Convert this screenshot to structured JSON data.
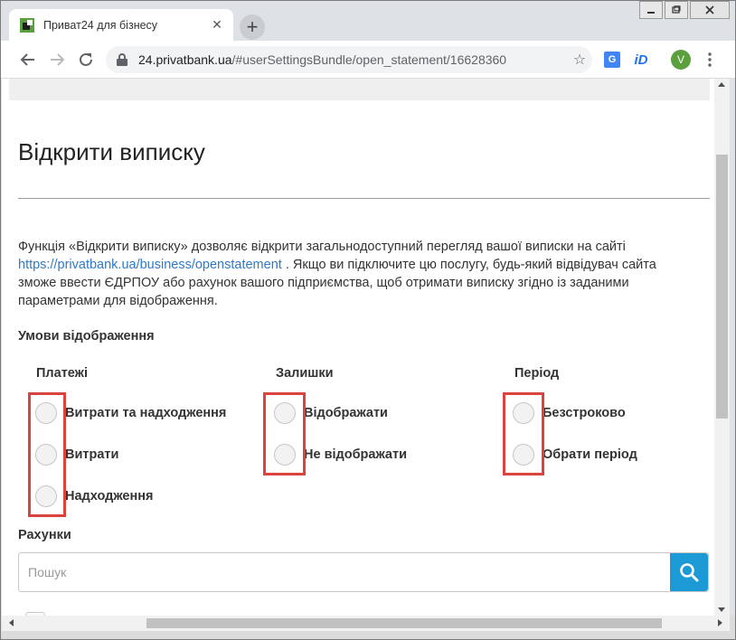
{
  "browser": {
    "tab_title": "Приват24 для бізнесу",
    "tab_close": "✕",
    "new_tab": "+",
    "url_host": "24.privatbank.ua",
    "url_path": "/#userSettingsBundle/open_statement/16628360",
    "profile_initial": "V",
    "id_ext": "iD",
    "translate_ext": "G"
  },
  "page": {
    "title": "Відкрити виписку",
    "description_before_link": "Функція «Відкрити виписку» дозволяє відкрити загальнодоступний перегляд вашої виписки на сайті ",
    "description_link": "https://privatbank.ua/business/openstatement",
    "description_after_link": " . Якщо ви підключите цю послугу, будь-який відвідувач сайта зможе ввести ЄДРПОУ або рахунок вашого підприємства, щоб отримати виписку згідно із заданими параметрами для відображення.",
    "display_conditions_label": "Умови відображення",
    "columns": {
      "payments": {
        "label": "Платежі",
        "options": [
          "Витрати та надходження",
          "Витрати",
          "Надходження"
        ]
      },
      "balances": {
        "label": "Залишки",
        "options": [
          "Відображати",
          "Не відображати"
        ]
      },
      "period": {
        "label": "Період",
        "options": [
          "Безстроково",
          "Обрати період"
        ]
      }
    },
    "accounts_label": "Рахунки",
    "search_placeholder": "Пошук"
  },
  "colors": {
    "accent": "#1c9ad6",
    "highlight": "#d9453e",
    "link": "#2f7ac8"
  }
}
